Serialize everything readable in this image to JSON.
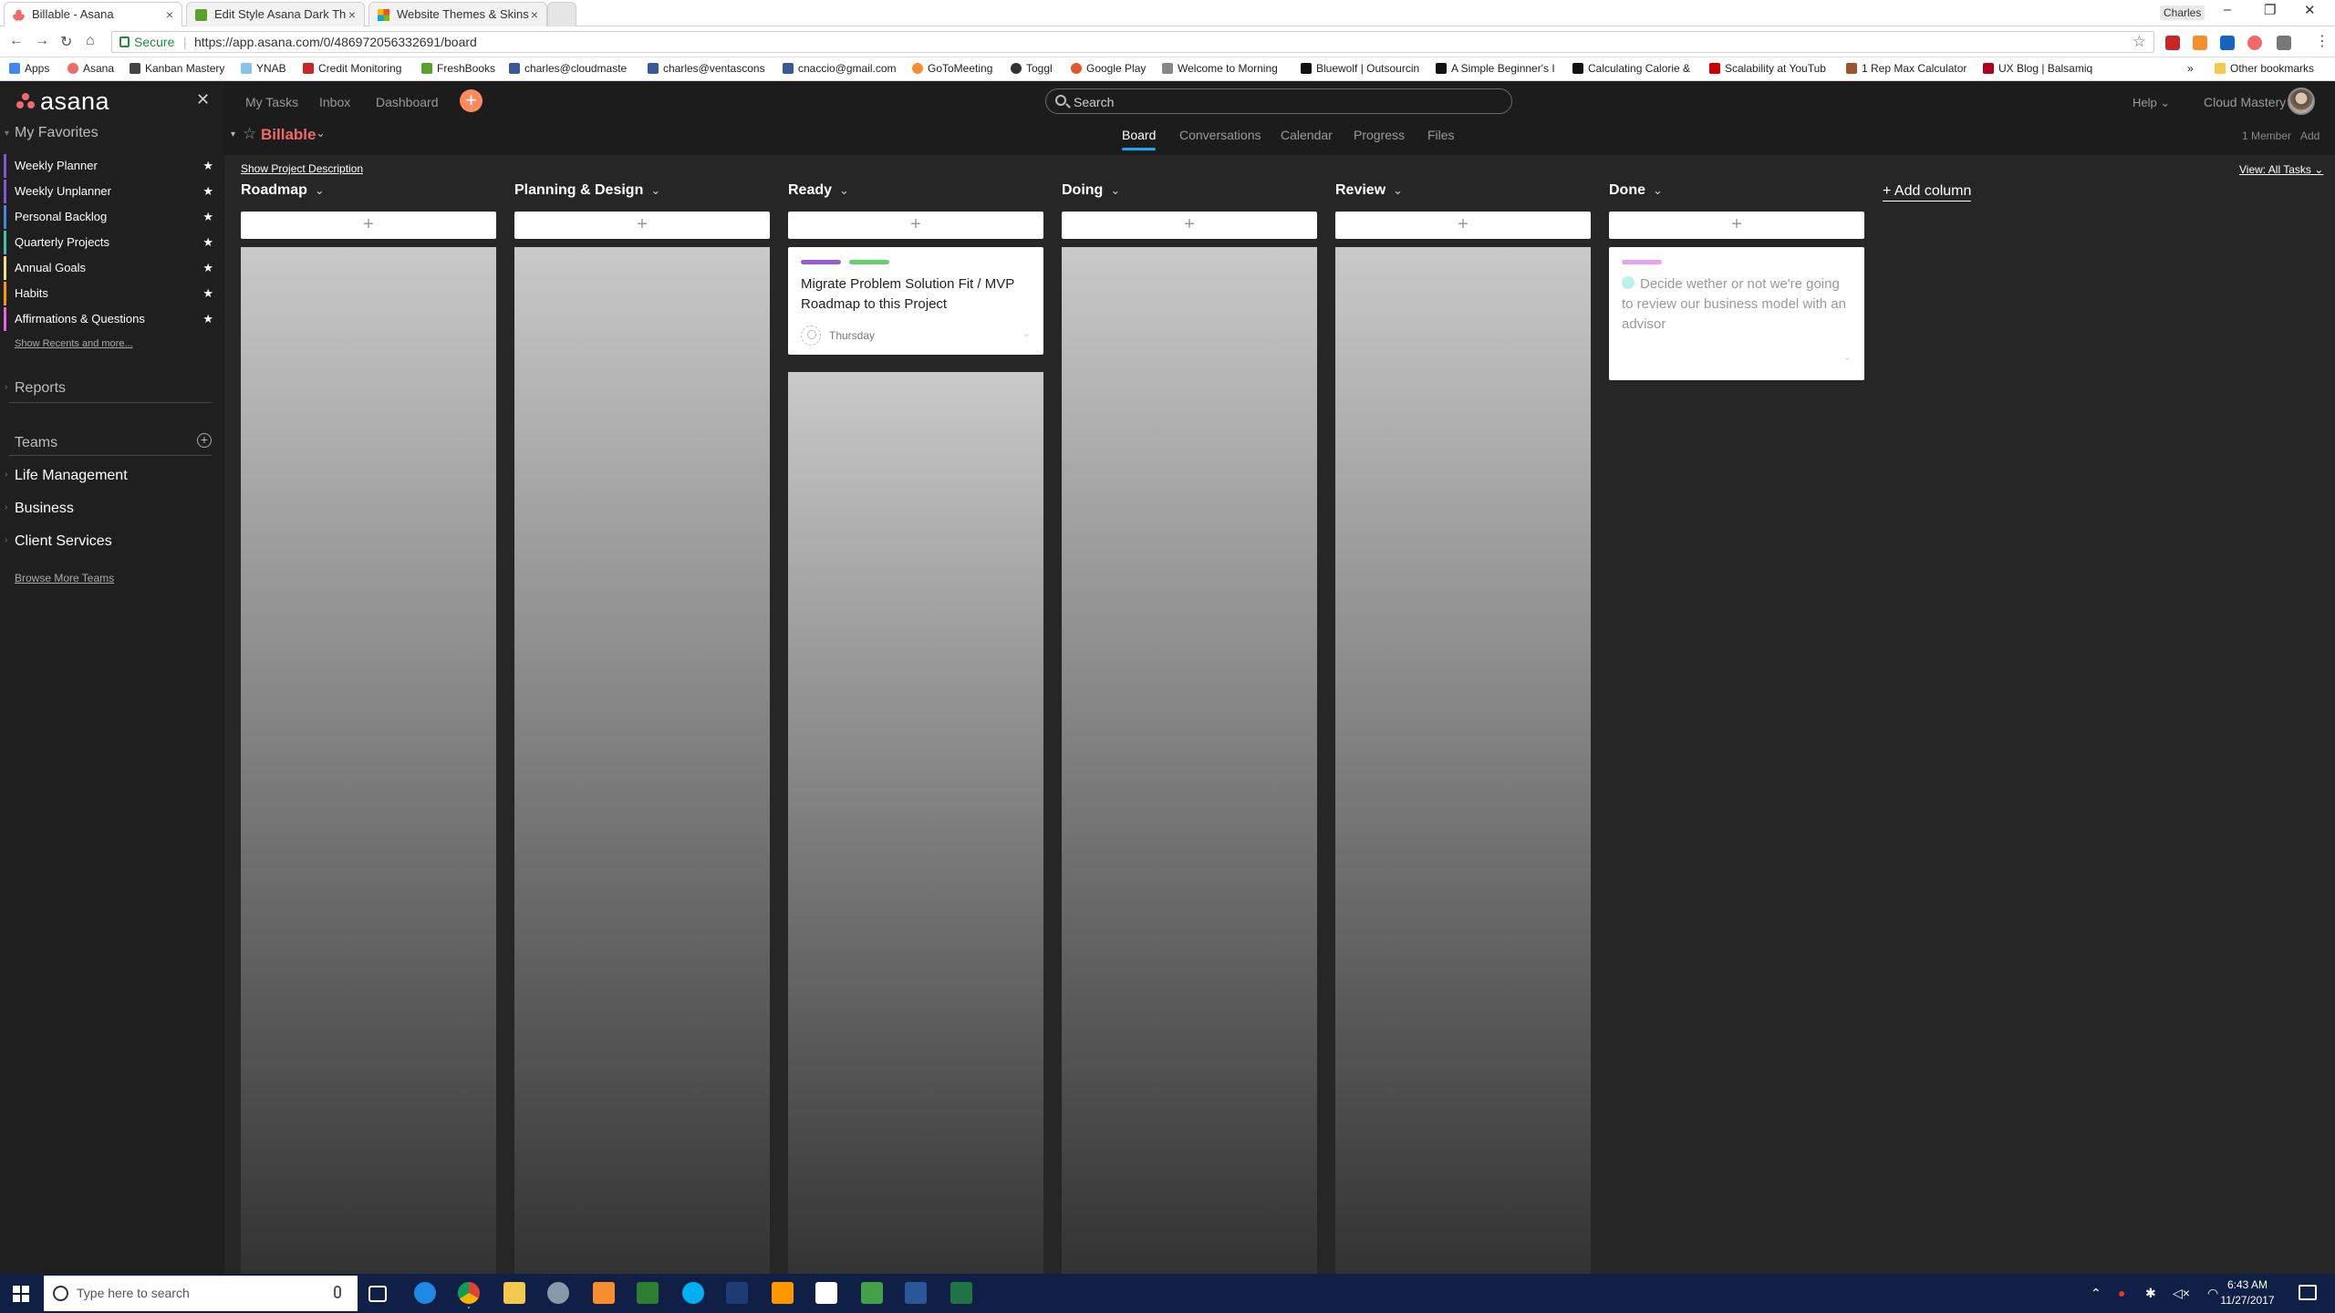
{
  "browser": {
    "tabs": [
      {
        "title": "Billable - Asana",
        "active": true
      },
      {
        "title": "Edit Style Asana Dark Th",
        "active": false
      },
      {
        "title": "Website Themes & Skins",
        "active": false
      }
    ],
    "user": "Charles",
    "secure_label": "Secure",
    "url": "https://app.asana.com/0/486972056332691/board",
    "bookmarks": [
      {
        "label": "Apps",
        "color": "#4285f4"
      },
      {
        "label": "Asana",
        "color": "#f06a6a"
      },
      {
        "label": "Kanban Mastery",
        "color": "#444444"
      },
      {
        "label": "YNAB",
        "color": "#85c3e9"
      },
      {
        "label": "Credit Monitoring",
        "color": "#c62828"
      },
      {
        "label": "FreshBooks",
        "color": "#5aa02c"
      },
      {
        "label": "charles@cloudmaste",
        "color": "#3b5998"
      },
      {
        "label": "charles@ventascons",
        "color": "#3b5998"
      },
      {
        "label": "cnaccio@gmail.com",
        "color": "#3b5998"
      },
      {
        "label": "GoToMeeting",
        "color": "#f68d2e"
      },
      {
        "label": "Toggl",
        "color": "#333333"
      },
      {
        "label": "Google Play",
        "color": "#e4572e"
      },
      {
        "label": "Welcome to Morning",
        "color": "#888888"
      },
      {
        "label": "Bluewolf | Outsourcin",
        "color": "#111111"
      },
      {
        "label": "A Simple Beginner's I",
        "color": "#111111"
      },
      {
        "label": "Calculating Calorie &",
        "color": "#111111"
      },
      {
        "label": "Scalability at YouTub",
        "color": "#cc0000"
      },
      {
        "label": "1 Rep Max Calculator",
        "color": "#a0522d"
      },
      {
        "label": "UX Blog | Balsamiq",
        "color": "#b00020"
      }
    ],
    "other_bookmarks": "Other bookmarks"
  },
  "sidebar": {
    "logo": "asana",
    "favorites_title": "My Favorites",
    "favorites": [
      {
        "label": "Weekly Planner",
        "color": "#7a5bd1"
      },
      {
        "label": "Weekly Unplanner",
        "color": "#7a5bd1"
      },
      {
        "label": "Personal Backlog",
        "color": "#4186e0"
      },
      {
        "label": "Quarterly Projects",
        "color": "#37c5ab"
      },
      {
        "label": "Annual Goals",
        "color": "#f8df72"
      },
      {
        "label": "Habits",
        "color": "#fd9a00"
      },
      {
        "label": "Affirmations & Questions",
        "color": "#e362e3"
      }
    ],
    "show_recents": "Show Recents and more...",
    "reports": "Reports",
    "teams_title": "Teams",
    "teams": [
      "Life Management",
      "Business",
      "Client Services"
    ],
    "browse_teams": "Browse More Teams"
  },
  "topbar": {
    "nav": [
      "My Tasks",
      "Inbox",
      "Dashboard"
    ],
    "search_placeholder": "Search",
    "help": "Help",
    "org": "Cloud Mastery"
  },
  "project": {
    "name": "Billable",
    "tabs": [
      "Board",
      "Conversations",
      "Calendar",
      "Progress",
      "Files"
    ],
    "active_tab": "Board",
    "members": "1 Member",
    "add": "Add",
    "show_description": "Show Project Description",
    "view": "View: All Tasks"
  },
  "board": {
    "columns": [
      {
        "title": "Roadmap",
        "cards": []
      },
      {
        "title": "Planning & Design",
        "cards": []
      },
      {
        "title": "Ready",
        "cards": [
          {
            "title": "Migrate Problem Solution Fit / MVP Roadmap to this Project",
            "tags": [
              "#9d5bd2",
              "#62d26f"
            ],
            "due": "Thursday",
            "done": false
          }
        ]
      },
      {
        "title": "Doing",
        "cards": []
      },
      {
        "title": "Review",
        "cards": []
      },
      {
        "title": "Done",
        "cards": [
          {
            "title": "Decide wether or not we're going to review our business model with an advisor",
            "tags": [
              "#e8a3ee"
            ],
            "due": "",
            "done": true
          }
        ]
      }
    ],
    "add_column": "+ Add column"
  },
  "taskbar": {
    "search_placeholder": "Type here to search",
    "time": "6:43 AM",
    "date": "11/27/2017"
  }
}
